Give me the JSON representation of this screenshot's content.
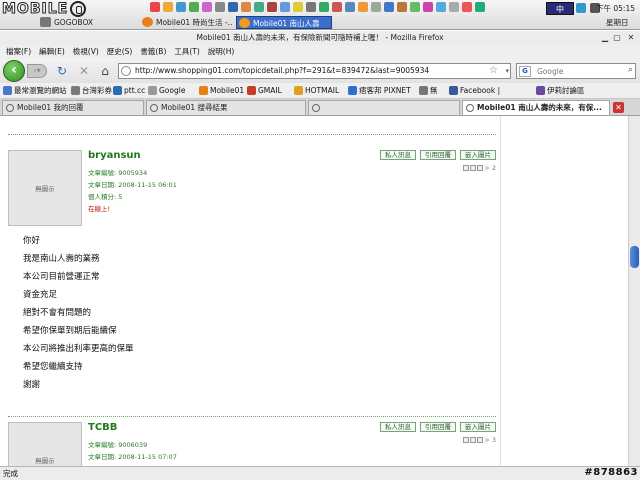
{
  "taskbar": {
    "brand": "MOBILE",
    "buttons": [
      "GOGOBOX",
      "Mobile01 時尚生活 -...",
      "Mobile01 南山人壽"
    ],
    "ime": "中",
    "clock": "下午 05:15",
    "day": "星期日"
  },
  "window": {
    "title": "Mobile01 南山人壽的未來，有保險新聞可隨時補上喔！ - Mozilla Firefox"
  },
  "menu": [
    "檔案(F)",
    "編輯(E)",
    "檢視(V)",
    "歷史(S)",
    "書籤(B)",
    "工具(T)",
    "說明(H)"
  ],
  "nav": {
    "url": "http://www.shopping01.com/topicdetail.php?f=291&t=839472&last=9005934",
    "search_placeholder": "Google",
    "search_engine": "G"
  },
  "bookmarks": [
    "最常瀏覽的網站",
    "台灣彩券",
    "ptt.cc",
    "Google",
    "Mobile01",
    "GMAIL",
    "HOTMAIL",
    "痞客邦 PIXNET",
    "無",
    "Facebook |",
    "伊莉討論區"
  ],
  "bookmark_icons": [
    "#4a78c8",
    "#7a7a7a",
    "#2b6bb5",
    "#999999",
    "#e8801a",
    "#c83a2a",
    "#e0a020",
    "#2f6fd0",
    "#777777",
    "#3b5998",
    "#6a4aa0"
  ],
  "tabs": [
    "Mobile01 我的回覆",
    "Mobile01 搜尋結果",
    "",
    "Mobile01 南山人壽的未來，有保..."
  ],
  "posts": [
    {
      "username": "bryansun",
      "avatar": "無圖示",
      "post_id_label": "文章編號: 9005934",
      "date_label": "文章日期: 2008-11-15 06:01",
      "score_label": "個人積分: 5",
      "online": "在線上!",
      "buttons": [
        "私人訊息",
        "引用回覆",
        "嵌入圖片"
      ],
      "pager": "> 2",
      "lines": [
        "你好",
        "我是南山人壽的業務",
        "本公司目前營運正常",
        "資金充足",
        "絕對不會有問題的",
        "希望你保單到期后能續保",
        "本公司將推出利率更高的保單",
        "希望您繼續支持",
        "謝謝"
      ]
    },
    {
      "username": "TCBB",
      "avatar": "無圖示",
      "post_id_label": "文章編號: 9006039",
      "date_label": "文章日期: 2008-11-15 07:07",
      "buttons": [
        "私人訊息",
        "引用回覆",
        "嵌入圖片"
      ],
      "pager": "> 3"
    }
  ],
  "status": {
    "text": "完成",
    "watermark": "#878863"
  }
}
